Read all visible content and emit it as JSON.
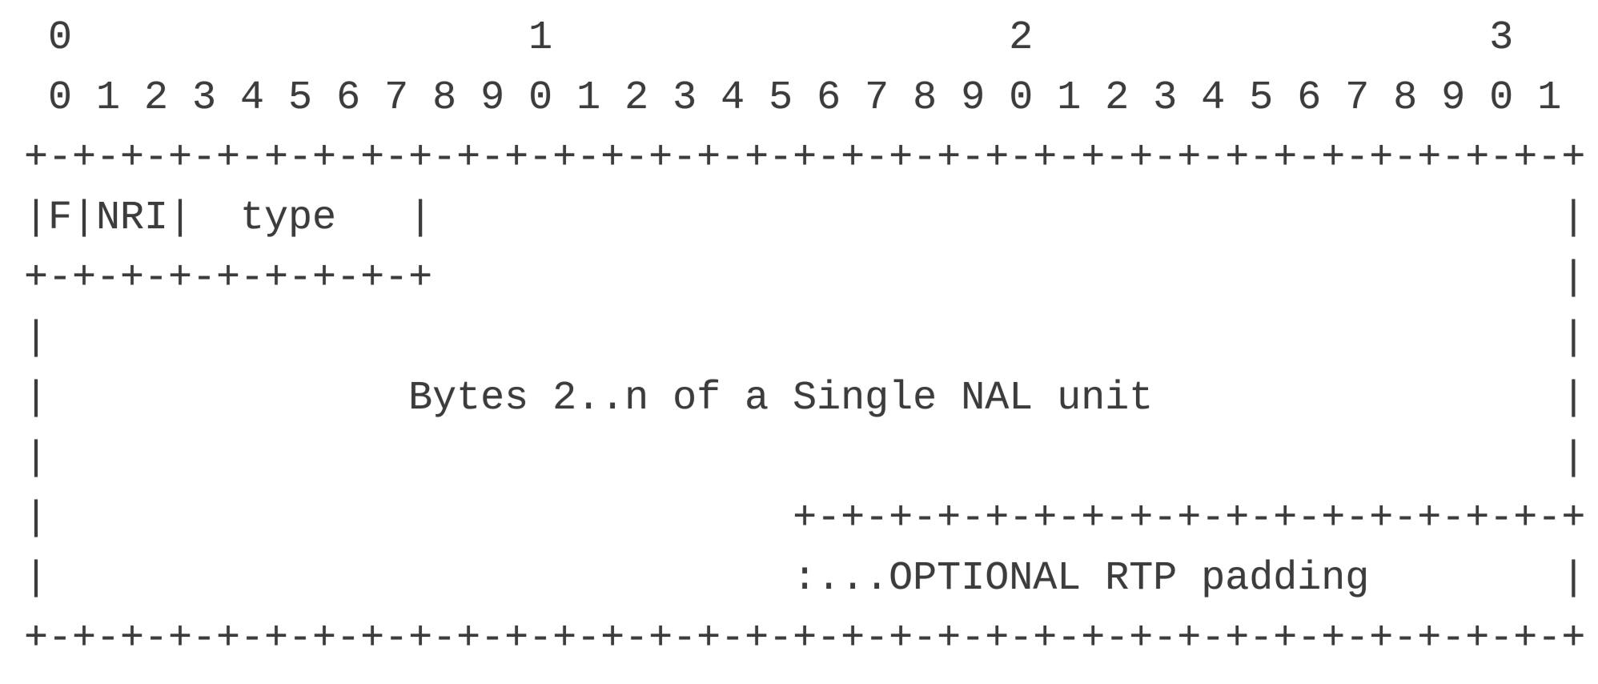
{
  "diagram": {
    "lines": [
      " 0                   1                   2                   3",
      " 0 1 2 3 4 5 6 7 8 9 0 1 2 3 4 5 6 7 8 9 0 1 2 3 4 5 6 7 8 9 0 1",
      "+-+-+-+-+-+-+-+-+-+-+-+-+-+-+-+-+-+-+-+-+-+-+-+-+-+-+-+-+-+-+-+-+",
      "|F|NRI|  type   |                                               |",
      "+-+-+-+-+-+-+-+-+                                               |",
      "|                                                               |",
      "|               Bytes 2..n of a Single NAL unit                 |",
      "|                                                               |",
      "|                               +-+-+-+-+-+-+-+-+-+-+-+-+-+-+-+-+",
      "|                               :...OPTIONAL RTP padding        |",
      "+-+-+-+-+-+-+-+-+-+-+-+-+-+-+-+-+-+-+-+-+-+-+-+-+-+-+-+-+-+-+-+-+"
    ],
    "text_color": "#3c3c3c"
  }
}
